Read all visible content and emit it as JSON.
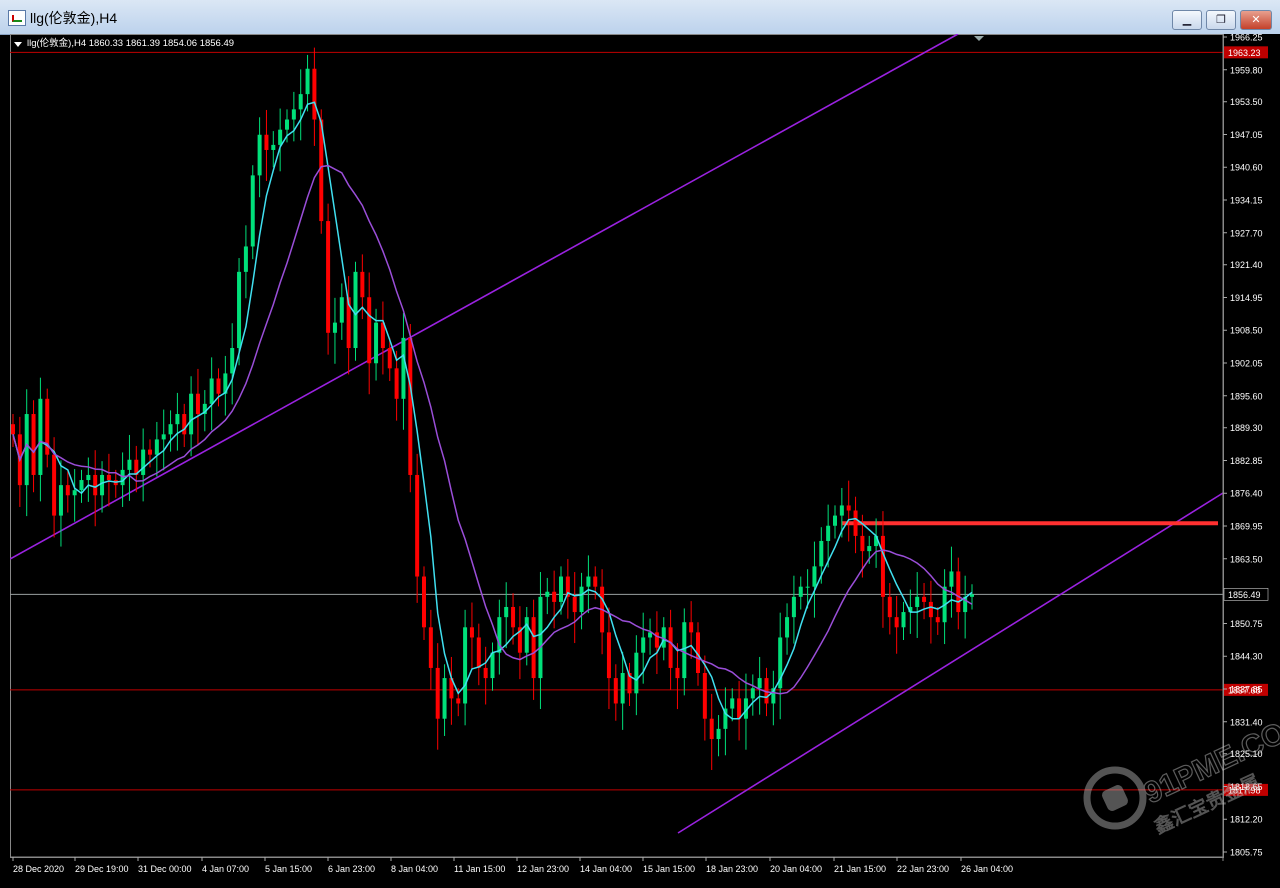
{
  "window": {
    "title": "llg(伦敦金),H4",
    "minimize_glyph": "▁",
    "restore_glyph": "❐",
    "close_glyph": "✕"
  },
  "chart_info": {
    "header": "llg(伦敦金),H4  1860.33 1861.39 1854.06 1856.49",
    "current_price": "1856.49"
  },
  "watermark": {
    "line1": "91PME.COM",
    "line2": "鑫汇宝贵金属"
  },
  "colors": {
    "background": "#000000",
    "bull_candle": "#00e07a",
    "bear_candle": "#ff0000",
    "fast_ma": "#40e0f0",
    "slow_ma": "#9a4ed8",
    "trendline": "#9a22e0",
    "resistance": "#ff3030",
    "hline": "#c00000",
    "price_line": "#9aa0a0",
    "axis_text": "#ffffff"
  },
  "chart_data": {
    "type": "candlestick",
    "symbol": "llg(伦敦金)",
    "timeframe": "H4",
    "ohlc_current": {
      "open": 1860.33,
      "high": 1861.39,
      "low": 1854.06,
      "close": 1856.49
    },
    "ylim": [
      1805.75,
      1966.25
    ],
    "y_ticks": [
      "1966.25",
      "1959.80",
      "1953.50",
      "1947.05",
      "1940.60",
      "1934.15",
      "1927.70",
      "1921.40",
      "1914.95",
      "1908.50",
      "1902.05",
      "1895.60",
      "1889.30",
      "1882.85",
      "1876.40",
      "1869.95",
      "1863.50",
      "1856.49",
      "1850.75",
      "1844.30",
      "1837.85",
      "1831.40",
      "1825.10",
      "1818.65",
      "1812.20",
      "1805.75"
    ],
    "x_ticks": [
      "28 Dec 2020",
      "29 Dec 19:00",
      "31 Dec 00:00",
      "4 Jan 07:00",
      "5 Jan 15:00",
      "6 Jan 23:00",
      "8 Jan 04:00",
      "11 Jan 15:00",
      "12 Jan 23:00",
      "14 Jan 04:00",
      "15 Jan 15:00",
      "18 Jan 23:00",
      "20 Jan 04:00",
      "21 Jan 15:00",
      "22 Jan 23:00",
      "26 Jan 04:00"
    ],
    "horizontal_lines": [
      {
        "price": 1963.23,
        "label": "1963.23"
      },
      {
        "price": 1837.68,
        "label": "1837.68"
      },
      {
        "price": 1817.98,
        "label": "1817.98"
      }
    ],
    "resistance_level": 1870.5,
    "closes": [
      1888,
      1878,
      1892,
      1880,
      1895,
      1884,
      1872,
      1878,
      1876,
      1877,
      1879,
      1880,
      1876,
      1880,
      1879,
      1878,
      1881,
      1883,
      1880,
      1885,
      1884,
      1887,
      1888,
      1890,
      1892,
      1888,
      1896,
      1892,
      1894,
      1899,
      1896,
      1900,
      1905,
      1920,
      1925,
      1939,
      1947,
      1944,
      1945,
      1948,
      1950,
      1952,
      1955,
      1960,
      1950,
      1930,
      1908,
      1910,
      1915,
      1905,
      1920,
      1915,
      1902,
      1910,
      1905,
      1901,
      1895,
      1907,
      1880,
      1860,
      1850,
      1842,
      1832,
      1840,
      1836,
      1835,
      1850,
      1848,
      1842,
      1840,
      1845,
      1852,
      1854,
      1850,
      1845,
      1852,
      1840,
      1856,
      1857,
      1855,
      1860,
      1856,
      1853,
      1858,
      1860,
      1858,
      1849,
      1840,
      1835,
      1841,
      1837,
      1845,
      1848,
      1849,
      1846,
      1850,
      1842,
      1840,
      1851,
      1849,
      1841,
      1832,
      1828,
      1830,
      1834,
      1836,
      1832,
      1836,
      1838,
      1840,
      1835,
      1838,
      1848,
      1852,
      1856,
      1858,
      1858,
      1862,
      1867,
      1870,
      1872,
      1874,
      1873,
      1868,
      1865,
      1866,
      1868,
      1856,
      1852,
      1850,
      1853,
      1854,
      1856,
      1855,
      1852,
      1851,
      1858,
      1861,
      1853,
      1856,
      1856.49
    ]
  }
}
